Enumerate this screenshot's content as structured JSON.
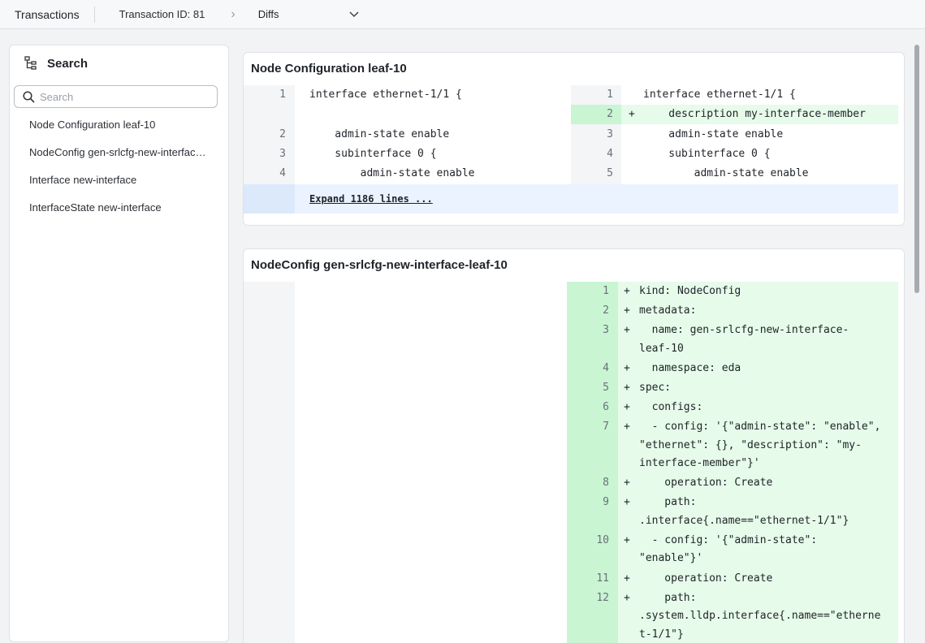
{
  "topbar": {
    "transactions": "Transactions",
    "transaction_id": "Transaction ID: 81",
    "view": "Diffs"
  },
  "sidebar": {
    "title": "Search",
    "search_placeholder": "Search",
    "items": [
      {
        "label": "Node Configuration leaf-10"
      },
      {
        "label": "NodeConfig gen-srlcfg-new-interface-leaf-10"
      },
      {
        "label": "Interface new-interface"
      },
      {
        "label": "InterfaceState new-interface"
      }
    ]
  },
  "diff1": {
    "title": "Node Configuration leaf-10",
    "left": [
      {
        "n": "1",
        "text": "interface ethernet-1/1 {"
      },
      {
        "n": "",
        "text": ""
      },
      {
        "n": "2",
        "text": "    admin-state enable"
      },
      {
        "n": "3",
        "text": "    subinterface 0 {"
      },
      {
        "n": "4",
        "text": "        admin-state enable"
      }
    ],
    "right": [
      {
        "n": "1",
        "text": "interface ethernet-1/1 {",
        "mark": ""
      },
      {
        "n": "2",
        "text": "    description my-interface-member",
        "mark": "+"
      },
      {
        "n": "3",
        "text": "    admin-state enable",
        "mark": ""
      },
      {
        "n": "4",
        "text": "    subinterface 0 {",
        "mark": ""
      },
      {
        "n": "5",
        "text": "        admin-state enable",
        "mark": ""
      }
    ],
    "expand": "Expand 1186 lines ..."
  },
  "diff2": {
    "title": "NodeConfig gen-srlcfg-new-interface-leaf-10",
    "lines": [
      {
        "n": "1",
        "mark": "+",
        "text": [
          "kind: NodeConfig"
        ]
      },
      {
        "n": "2",
        "mark": "+",
        "text": [
          "metadata:"
        ]
      },
      {
        "n": "3",
        "mark": "+",
        "text": [
          "  name: gen-srlcfg-new-interface-",
          "leaf-10"
        ]
      },
      {
        "n": "4",
        "mark": "+",
        "text": [
          "  namespace: eda"
        ]
      },
      {
        "n": "5",
        "mark": "+",
        "text": [
          "spec:"
        ]
      },
      {
        "n": "6",
        "mark": "+",
        "text": [
          "  configs:"
        ]
      },
      {
        "n": "7",
        "mark": "+",
        "text": [
          "  - config: '{\"admin-state\": \"enable\",",
          "\"ethernet\": {}, \"description\": \"my-",
          "interface-member\"}'"
        ]
      },
      {
        "n": "8",
        "mark": "+",
        "text": [
          "    operation: Create"
        ]
      },
      {
        "n": "9",
        "mark": "+",
        "text": [
          "    path:",
          ".interface{.name==\"ethernet-1/1\"}"
        ]
      },
      {
        "n": "10",
        "mark": "+",
        "text": [
          "  - config: '{\"admin-state\":",
          "\"enable\"}'"
        ]
      },
      {
        "n": "11",
        "mark": "+",
        "text": [
          "    operation: Create"
        ]
      },
      {
        "n": "12",
        "mark": "+",
        "text": [
          "    path:",
          ".system.lldp.interface{.name==\"etherne",
          "t-1/1\"}"
        ]
      }
    ]
  },
  "colors": {
    "added_bg": "#e6fbe9",
    "added_gutter": "#c9f5d3",
    "expand_bg": "#eaf3ff"
  }
}
